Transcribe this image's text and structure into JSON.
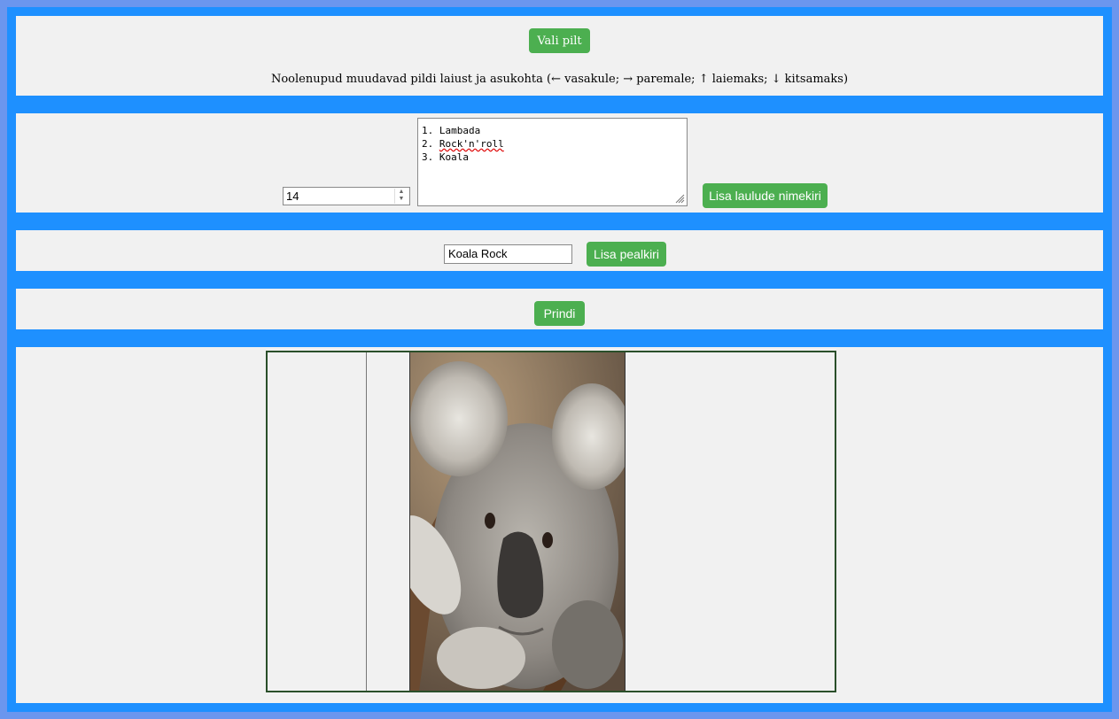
{
  "buttons": {
    "choose_image": "Vali pilt",
    "add_songlist": "Lisa laulude nimekiri",
    "add_title": "Lisa pealkiri",
    "print": "Prindi"
  },
  "hint": "Noolenupud muudavad pildi laiust ja asukohta (← vasakule; → paremale; ↑ laiemaks; ↓ kitsamaks)",
  "font_size_input": {
    "value": "14"
  },
  "songlist": {
    "lines": [
      "1. Lambada",
      "2. ",
      "3. Koala"
    ],
    "line2_word": "Rock'n'roll"
  },
  "title_input": {
    "value": "Koala Rock"
  },
  "image": {
    "subject": "koala-photo"
  },
  "colors": {
    "accent": "#4caf50",
    "frame": "#1e90ff",
    "panel": "#f1f1f1",
    "page": "#6b96ee"
  }
}
